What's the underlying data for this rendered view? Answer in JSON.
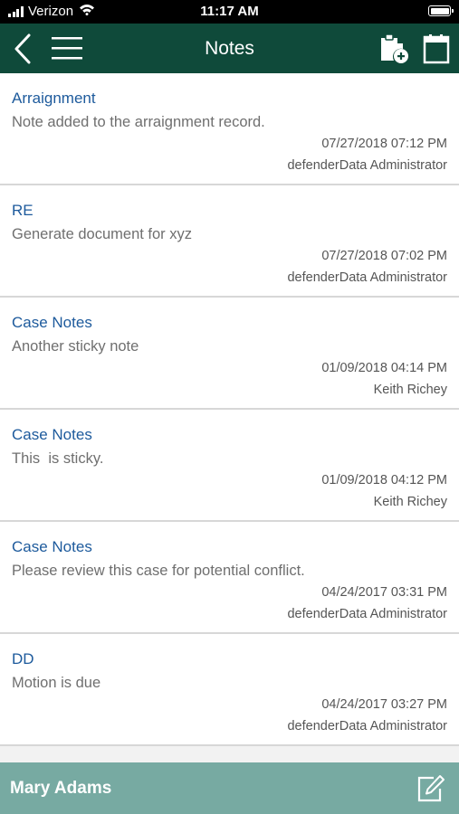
{
  "status_bar": {
    "carrier": "Verizon",
    "time": "11:17 AM",
    "icons": [
      "signal-icon",
      "wifi-icon",
      "battery-icon"
    ]
  },
  "header": {
    "title": "Notes",
    "icons": [
      "back-chevron-icon",
      "hamburger-menu-icon",
      "add-note-icon",
      "notepad-icon"
    ],
    "background_color": "#0f4a3a"
  },
  "notes": [
    {
      "title": "Arraignment",
      "body": "Note added to the arraignment record.",
      "date": "07/27/2018 07:12 PM",
      "author": "defenderData Administrator"
    },
    {
      "title": "RE",
      "body": "Generate document for xyz",
      "date": "07/27/2018 07:02 PM",
      "author": "defenderData Administrator"
    },
    {
      "title": "Case Notes",
      "body": "Another sticky note",
      "date": "01/09/2018 04:14 PM",
      "author": "Keith Richey"
    },
    {
      "title": "Case Notes",
      "body": "This  is sticky.",
      "date": "01/09/2018 04:12 PM",
      "author": "Keith Richey"
    },
    {
      "title": "Case Notes",
      "body": "Please review this case for potential conflict.",
      "date": "04/24/2017 03:31 PM",
      "author": "defenderData Administrator"
    },
    {
      "title": "DD",
      "body": "Motion is due",
      "date": "04/24/2017 03:27 PM",
      "author": "defenderData Administrator"
    }
  ],
  "footer": {
    "name": "Mary Adams",
    "icon": "edit-icon",
    "background_color": "#77aaa2"
  },
  "colors": {
    "note_title": "#1d5a9c",
    "note_body": "#6f6f6f"
  }
}
